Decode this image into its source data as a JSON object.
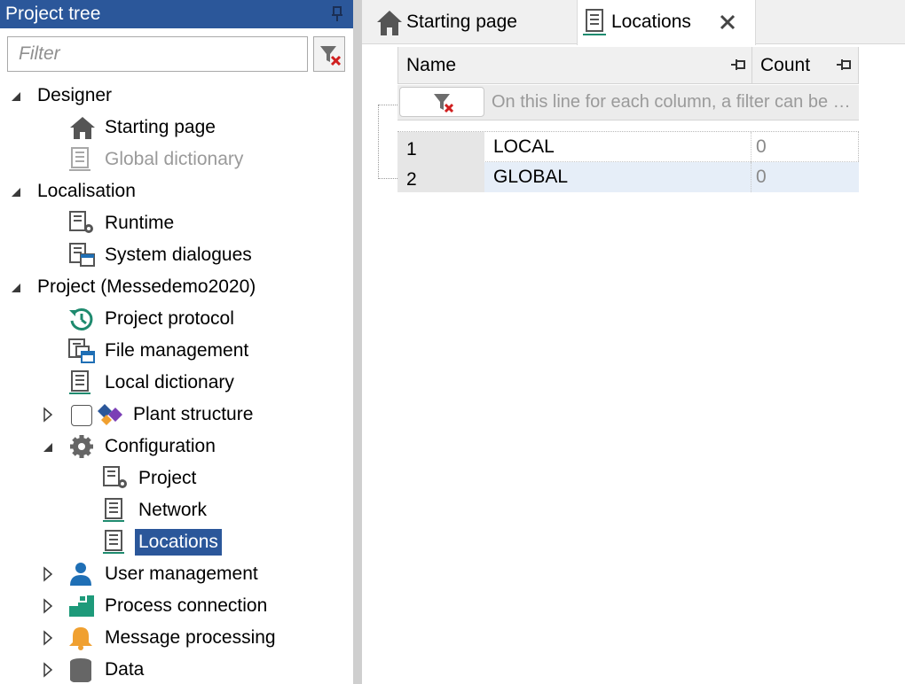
{
  "left_pane": {
    "title": "Project tree",
    "filter_placeholder": "Filter",
    "tree": {
      "designer": {
        "label": "Designer",
        "starting_page": "Starting page",
        "global_dictionary": "Global dictionary"
      },
      "localisation": {
        "label": "Localisation",
        "runtime": "Runtime",
        "system_dialogues": "System dialogues"
      },
      "project": {
        "label": "Project (Messedemo2020)",
        "project_protocol": "Project protocol",
        "file_management": "File management",
        "local_dictionary": "Local dictionary",
        "plant_structure": "Plant structure",
        "configuration": {
          "label": "Configuration",
          "project": "Project",
          "network": "Network",
          "locations": "Locations"
        },
        "user_management": "User management",
        "process_connection": "Process connection",
        "message_processing": "Message processing",
        "data": "Data"
      }
    },
    "selected_item": "Locations",
    "plant_structure_checked": false
  },
  "tabs": [
    {
      "label": "Starting page",
      "icon": "home-icon",
      "active": false
    },
    {
      "label": "Locations",
      "icon": "dictionary-icon",
      "active": true
    }
  ],
  "grid": {
    "columns": [
      "Name",
      "Count"
    ],
    "filter_hint": "On this line for each column, a filter can be defined",
    "rows": [
      {
        "num": "1",
        "name": "LOCAL",
        "count": "0"
      },
      {
        "num": "2",
        "name": "GLOBAL",
        "count": "0"
      }
    ]
  },
  "colors": {
    "header_blue": "#2b579a",
    "selection_blue": "#2b579a",
    "row_highlight": "#e6eef8",
    "history_green": "#1e8a6e",
    "user_blue": "#1f6fb5",
    "bell_orange": "#f0a030"
  }
}
